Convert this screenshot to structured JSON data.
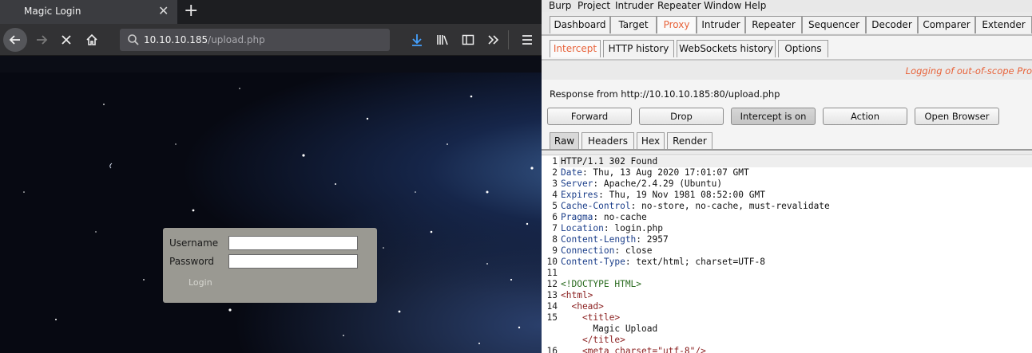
{
  "firefox": {
    "tab_title": "Magic Login",
    "tab_close": "✕",
    "newtab": "+",
    "url_host": "10.10.10.185",
    "url_path": "/upload.php",
    "login": {
      "username_label": "Username",
      "password_label": "Password",
      "login_button": "Login"
    }
  },
  "burp": {
    "menu": [
      "Burp",
      "Project",
      "Intruder",
      "Repeater",
      "Window",
      "Help"
    ],
    "main_tabs": [
      "Dashboard",
      "Target",
      "Proxy",
      "Intruder",
      "Repeater",
      "Sequencer",
      "Decoder",
      "Comparer",
      "Extender"
    ],
    "active_main_tab": "Proxy",
    "proxy_tabs": [
      "Intercept",
      "HTTP history",
      "WebSockets history",
      "Options"
    ],
    "active_proxy_tab": "Intercept",
    "logging_message": "Logging of out-of-scope Pro",
    "response_from": "Response from http://10.10.10.185:80/upload.php",
    "buttons": {
      "forward": "Forward",
      "drop": "Drop",
      "intercept": "Intercept is on",
      "action": "Action",
      "open_browser": "Open Browser"
    },
    "view_tabs": [
      "Raw",
      "Headers",
      "Hex",
      "Render"
    ],
    "active_view_tab": "Raw",
    "accent_color": "#e8633a",
    "response_lines": [
      {
        "n": "1",
        "key": "",
        "val": "HTTP/1.1 302 Found"
      },
      {
        "n": "2",
        "key": "Date",
        "val": ": Thu, 13 Aug 2020 17:01:07 GMT"
      },
      {
        "n": "3",
        "key": "Server",
        "val": ": Apache/2.4.29 (Ubuntu)"
      },
      {
        "n": "4",
        "key": "Expires",
        "val": ": Thu, 19 Nov 1981 08:52:00 GMT"
      },
      {
        "n": "5",
        "key": "Cache-Control",
        "val": ": no-store, no-cache, must-revalidate"
      },
      {
        "n": "6",
        "key": "Pragma",
        "val": ": no-cache"
      },
      {
        "n": "7",
        "key": "Location",
        "val": ": login.php"
      },
      {
        "n": "8",
        "key": "Content-Length",
        "val": ": 2957"
      },
      {
        "n": "9",
        "key": "Connection",
        "val": ": close"
      },
      {
        "n": "10",
        "key": "Content-Type",
        "val": ": text/html; charset=UTF-8"
      },
      {
        "n": "11",
        "key": "",
        "val": ""
      },
      {
        "n": "12",
        "key": "",
        "val": "<!DOCTYPE HTML>"
      },
      {
        "n": "13",
        "key": "",
        "val": "<html>"
      },
      {
        "n": "14",
        "key": "",
        "val": "  <head>"
      },
      {
        "n": "15",
        "key": "",
        "val": "    <title>"
      },
      {
        "n": "",
        "key": "",
        "val": "      Magic Upload"
      },
      {
        "n": "",
        "key": "",
        "val": "    </title>"
      },
      {
        "n": "16",
        "key": "",
        "val": "    <meta charset=\"utf-8\"/>"
      }
    ]
  }
}
